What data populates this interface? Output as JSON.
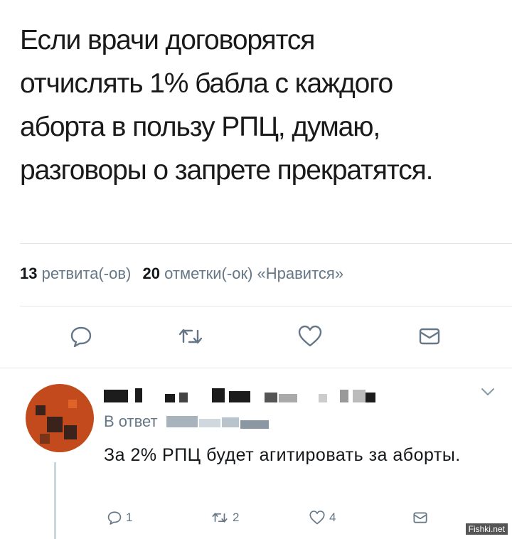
{
  "tweet": {
    "text": "Если врачи договорятся\nотчислять 1% бабла с каждого\nаборта в пользу РПЦ, думаю,\nразговоры о запрете прекратятся.",
    "retweets_count": "13",
    "retweets_label": "ретвита(-ов)",
    "likes_count": "20",
    "likes_label": "отметки(-ок) «Нравится»",
    "action_icons": [
      "reply-icon",
      "retweet-icon",
      "like-icon",
      "message-icon"
    ]
  },
  "reply": {
    "in_reply_to_label": "В ответ",
    "text": "За 2% РПЦ будет агитировать за аборты.",
    "reply_count": "1",
    "retweet_count": "2",
    "like_count": "4",
    "avatar_color": "#c24a1c"
  },
  "watermark": "Fishki.net",
  "colors": {
    "text": "#14171a",
    "muted": "#657786",
    "divider": "#e1e8ed",
    "icon": "#657786"
  }
}
